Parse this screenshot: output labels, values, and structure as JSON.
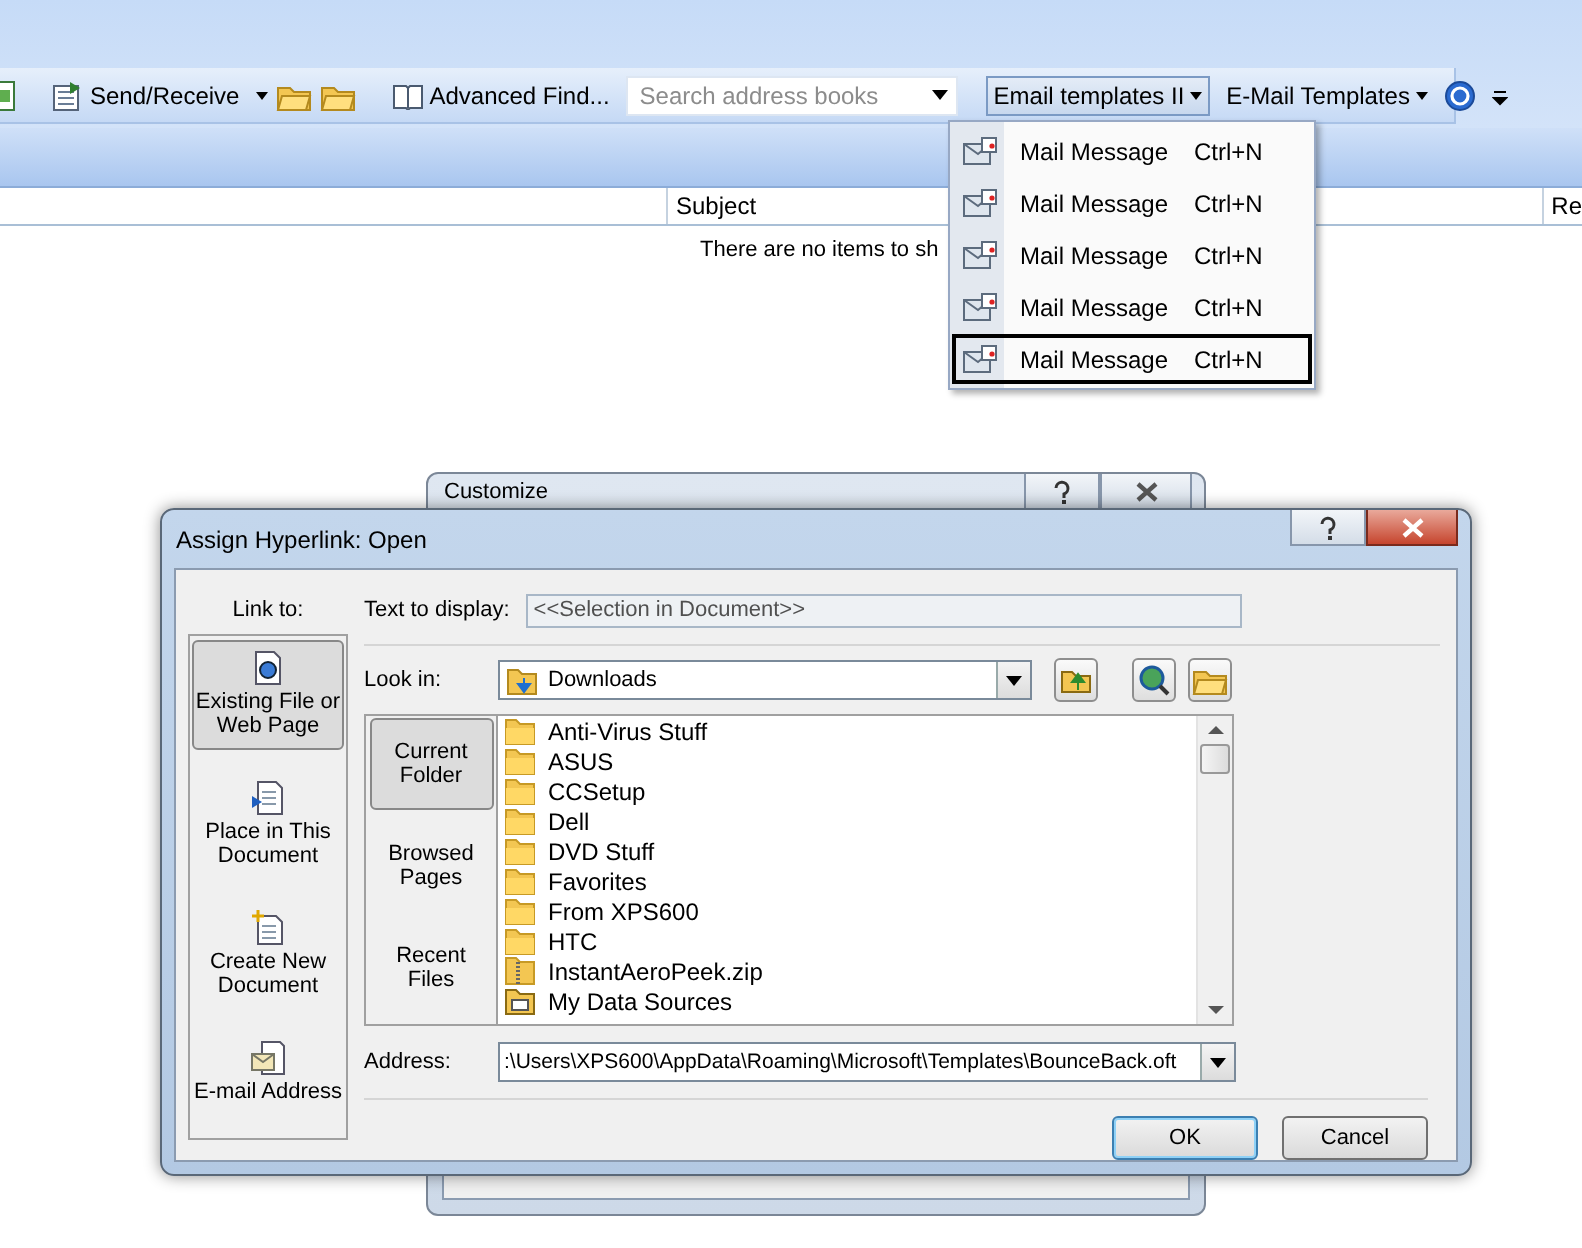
{
  "toolbar": {
    "send_receive": "Send/Receive",
    "advanced_find": "Advanced Find...",
    "search": {
      "placeholder": "Search address books"
    },
    "template_buttons": [
      {
        "label": "Email templates II",
        "selected": true
      },
      {
        "label": "E-Mail Templates",
        "selected": false
      }
    ]
  },
  "template_menu": [
    {
      "label": "Mail Message",
      "shortcut": "Ctrl+N",
      "selected": false
    },
    {
      "label": "Mail Message",
      "shortcut": "Ctrl+N",
      "selected": false
    },
    {
      "label": "Mail Message",
      "shortcut": "Ctrl+N",
      "selected": false
    },
    {
      "label": "Mail Message",
      "shortcut": "Ctrl+N",
      "selected": false
    },
    {
      "label": "Mail Message",
      "shortcut": "Ctrl+N",
      "selected": true
    }
  ],
  "message_list": {
    "columns": [
      "Subject",
      "Re"
    ],
    "empty_text": "There are no items to sh"
  },
  "customize_dialog": {
    "title": "Customize"
  },
  "hyperlink_dialog": {
    "title": "Assign Hyperlink: Open",
    "link_to_label": "Link to:",
    "link_to": [
      {
        "label": "Existing File or\nWeb Page",
        "kind": "file",
        "selected": true
      },
      {
        "label": "Place in This\nDocument",
        "kind": "place",
        "selected": false
      },
      {
        "label": "Create New\nDocument",
        "kind": "new",
        "selected": false
      },
      {
        "label": "E-mail Address",
        "kind": "email",
        "selected": false
      }
    ],
    "text_to_display": {
      "label": "Text to display:",
      "value": "<<Selection in Document>>"
    },
    "look_in": {
      "label": "Look in:",
      "value": "Downloads"
    },
    "places": [
      {
        "label": "Current\nFolder",
        "selected": true
      },
      {
        "label": "Browsed\nPages",
        "selected": false
      },
      {
        "label": "Recent\nFiles",
        "selected": false
      }
    ],
    "files": [
      {
        "name": "Anti-Virus Stuff",
        "kind": "folder"
      },
      {
        "name": "ASUS",
        "kind": "folder"
      },
      {
        "name": "CCSetup",
        "kind": "folder"
      },
      {
        "name": "Dell",
        "kind": "folder"
      },
      {
        "name": "DVD Stuff",
        "kind": "folder"
      },
      {
        "name": "Favorites",
        "kind": "folder"
      },
      {
        "name": "From XPS600",
        "kind": "folder"
      },
      {
        "name": "HTC",
        "kind": "folder"
      },
      {
        "name": "InstantAeroPeek.zip",
        "kind": "zip"
      },
      {
        "name": "My Data Sources",
        "kind": "datasource"
      }
    ],
    "address": {
      "label": "Address:",
      "value": ":\\Users\\XPS600\\AppData\\Roaming\\Microsoft\\Templates\\BounceBack.oft"
    },
    "buttons": [
      {
        "label": "OK",
        "default": true
      },
      {
        "label": "Cancel",
        "default": false
      }
    ]
  }
}
